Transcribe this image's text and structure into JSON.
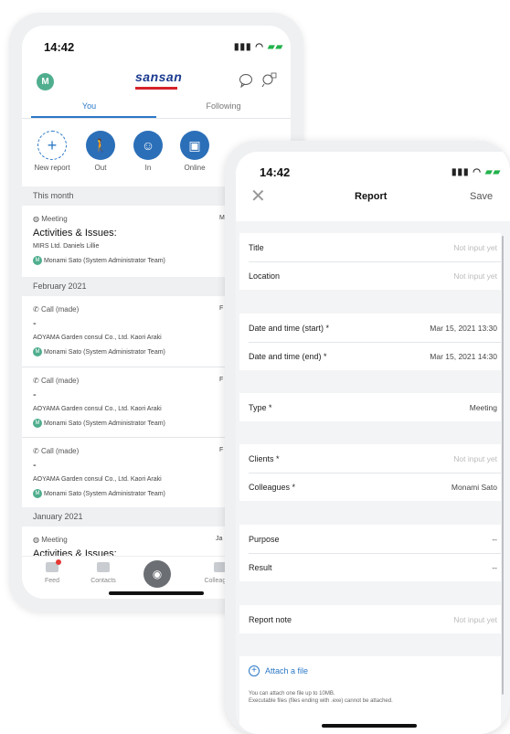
{
  "feed_screen": {
    "status": {
      "time": "14:42"
    },
    "header": {
      "avatar": "M",
      "logo": "sansan"
    },
    "tabs": [
      {
        "label": "You"
      },
      {
        "label": "Following"
      }
    ],
    "actions": [
      {
        "label": "New report",
        "icon": "plus-icon"
      },
      {
        "label": "Out",
        "icon": "walking-icon"
      },
      {
        "label": "In",
        "icon": "person-badge-icon"
      },
      {
        "label": "Online",
        "icon": "monitor-icon"
      }
    ],
    "sections": [
      {
        "title": "This month"
      },
      {
        "title": "February 2021"
      },
      {
        "title": "January 2021"
      }
    ],
    "items": [
      {
        "type": "Meeting",
        "title": "Activities & Issues:",
        "company": "MIRS Ltd.  Daniels Lillie",
        "person": "Monami Sato (System Administrator Team)",
        "edge": "M"
      },
      {
        "type": "Call (made)",
        "title": "-",
        "company": "AOYAMA Garden consul Co., Ltd.  Kaori Araki",
        "person": "Monami Sato (System Administrator Team)",
        "edge": "F"
      },
      {
        "type": "Call (made)",
        "title": "-",
        "company": "AOYAMA Garden consul Co., Ltd.  Kaori Araki",
        "person": "Monami Sato (System Administrator Team)",
        "edge": "F"
      },
      {
        "type": "Call (made)",
        "title": "-",
        "company": "AOYAMA Garden consul Co., Ltd.  Kaori Araki",
        "person": "Monami Sato (System Administrator Team)",
        "edge": "F"
      },
      {
        "type": "Meeting",
        "title": "Activities & Issues:",
        "edge": "Ja"
      }
    ],
    "avatar_initial": "M",
    "nav": [
      {
        "label": "Feed"
      },
      {
        "label": "Contacts"
      },
      {
        "label": ""
      },
      {
        "label": "Colleagues"
      }
    ]
  },
  "report_screen": {
    "status": {
      "time": "14:42"
    },
    "title": "Report",
    "save_label": "Save",
    "fields": {
      "title": {
        "label": "Title",
        "value": "Not input yet"
      },
      "location": {
        "label": "Location",
        "value": "Not input yet"
      },
      "start": {
        "label": "Date and time (start) *",
        "value": "Mar 15, 2021 13:30"
      },
      "end": {
        "label": "Date and time (end) *",
        "value": "Mar 15, 2021 14:30"
      },
      "type": {
        "label": "Type *",
        "value": "Meeting"
      },
      "clients": {
        "label": "Clients *",
        "value": "Not input yet"
      },
      "colleagues": {
        "label": "Colleagues *",
        "value": "Monami Sato"
      },
      "purpose": {
        "label": "Purpose",
        "value": "--"
      },
      "result": {
        "label": "Result",
        "value": "--"
      },
      "note": {
        "label": "Report note",
        "value": "Not input yet"
      }
    },
    "attach_label": "Attach a file",
    "attach_note_1": "You can attach one file up to 10MB.",
    "attach_note_2": "Executable files (files ending with .exe) cannot be attached."
  },
  "colors": {
    "accent": "#2b78c6",
    "brand_red": "#d6232a",
    "brand_blue": "#1a3a8f",
    "avatar_green": "#4fae8e"
  }
}
